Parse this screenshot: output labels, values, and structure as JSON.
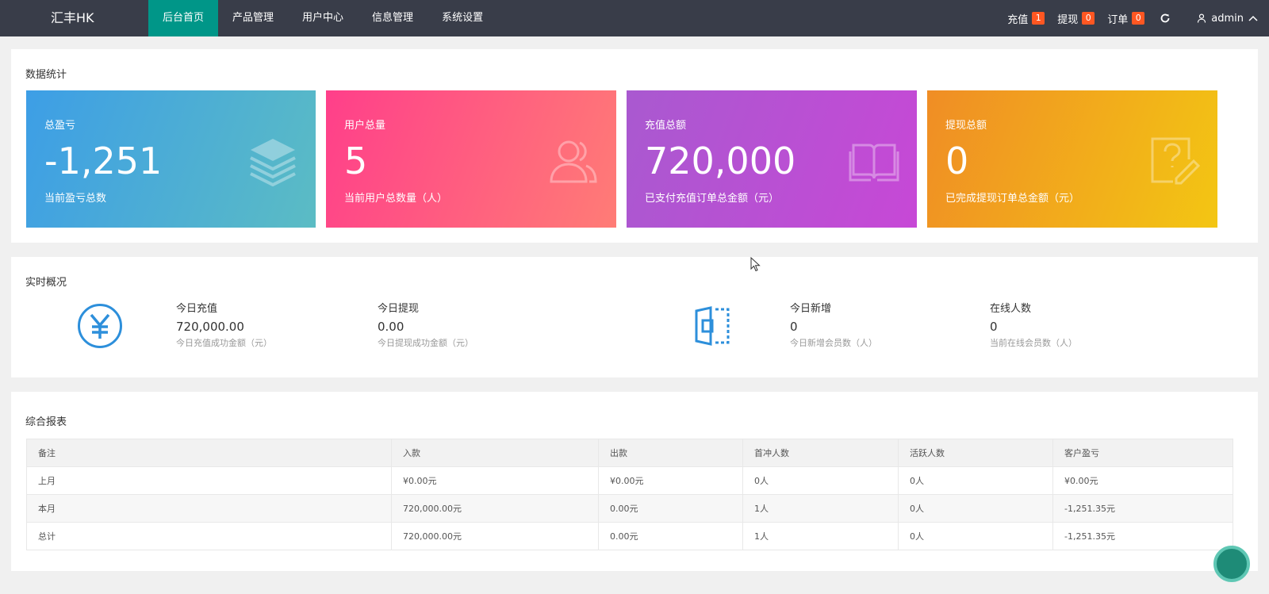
{
  "app": {
    "logo": "汇丰HK"
  },
  "nav": {
    "items": [
      {
        "label": "后台首页",
        "active": true
      },
      {
        "label": "产品管理",
        "active": false
      },
      {
        "label": "用户中心",
        "active": false
      },
      {
        "label": "信息管理",
        "active": false
      },
      {
        "label": "系统设置",
        "active": false
      }
    ],
    "right": {
      "recharge": {
        "label": "充值",
        "count": "1"
      },
      "withdraw": {
        "label": "提现",
        "count": "0"
      },
      "orders": {
        "label": "订单",
        "count": "0"
      },
      "user": "admin"
    }
  },
  "stats": {
    "title": "数据统计",
    "tiles": [
      {
        "label": "总盈亏",
        "value": "-1,251",
        "desc": "当前盈亏总数",
        "icon": "layers-icon"
      },
      {
        "label": "用户总量",
        "value": "5",
        "desc": "当前用户总数量（人）",
        "icon": "users-icon"
      },
      {
        "label": "充值总额",
        "value": "720,000",
        "desc": "已支付充值订单总金额（元）",
        "icon": "book-icon"
      },
      {
        "label": "提现总额",
        "value": "0",
        "desc": "已完成提现订单总金额（元）",
        "icon": "edit-icon"
      }
    ]
  },
  "realtime": {
    "title": "实时概况",
    "items": [
      {
        "label": "今日充值",
        "value": "720,000.00",
        "desc": "今日充值成功金额（元）"
      },
      {
        "label": "今日提现",
        "value": "0.00",
        "desc": "今日提现成功金额（元）"
      },
      {
        "label": "今日新增",
        "value": "0",
        "desc": "今日新增会员数（人）"
      },
      {
        "label": "在线人数",
        "value": "0",
        "desc": "当前在线会员数（人）"
      }
    ]
  },
  "report": {
    "title": "综合报表",
    "headers": [
      "备注",
      "入款",
      "出款",
      "首冲人数",
      "活跃人数",
      "客户盈亏"
    ],
    "rows": [
      [
        "上月",
        "¥0.00元",
        "¥0.00元",
        "0人",
        "0人",
        "¥0.00元"
      ],
      [
        "本月",
        "720,000.00元",
        "0.00元",
        "1人",
        "0人",
        "-1,251.35元"
      ],
      [
        "总计",
        "720,000.00元",
        "0.00元",
        "1人",
        "0人",
        "-1,251.35元"
      ]
    ]
  },
  "colors": {
    "topbar": "#393d49",
    "nav_active": "#009688",
    "badge": "#ff5722",
    "realtime_icon": "#2d8fdb"
  }
}
